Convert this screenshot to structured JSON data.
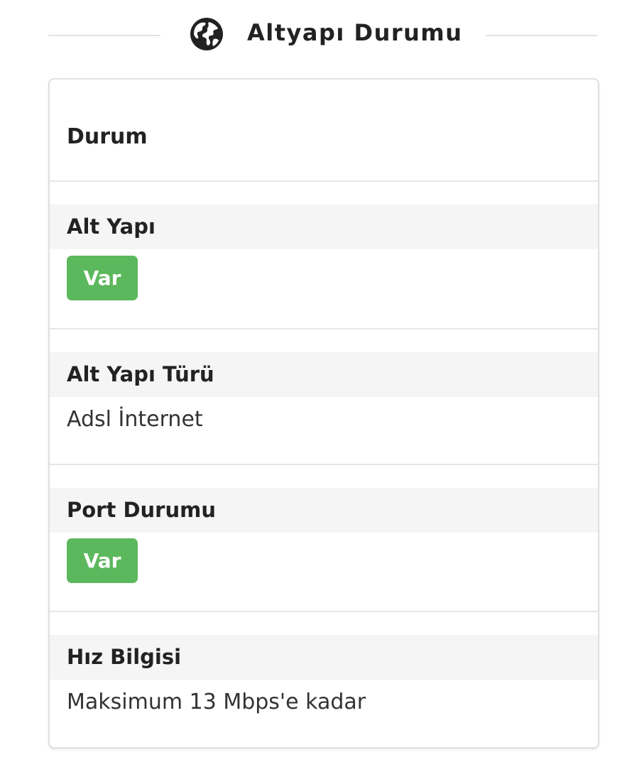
{
  "header": {
    "title": "Altyapı Durumu",
    "icon": "globe-icon"
  },
  "card": {
    "heading": "Durum",
    "sections": [
      {
        "label": "Alt Yapı",
        "badge": "Var"
      },
      {
        "label": "Alt Yapı Türü",
        "value": "Adsl İnternet"
      },
      {
        "label": "Port Durumu",
        "badge": "Var"
      },
      {
        "label": "Hız Bilgisi",
        "value": "Maksimum 13 Mbps'e kadar"
      }
    ]
  },
  "colors": {
    "badge_green": "#5cb85c",
    "label_band": "#f5f5f5",
    "border": "#e0e0e0",
    "text": "#222222"
  }
}
